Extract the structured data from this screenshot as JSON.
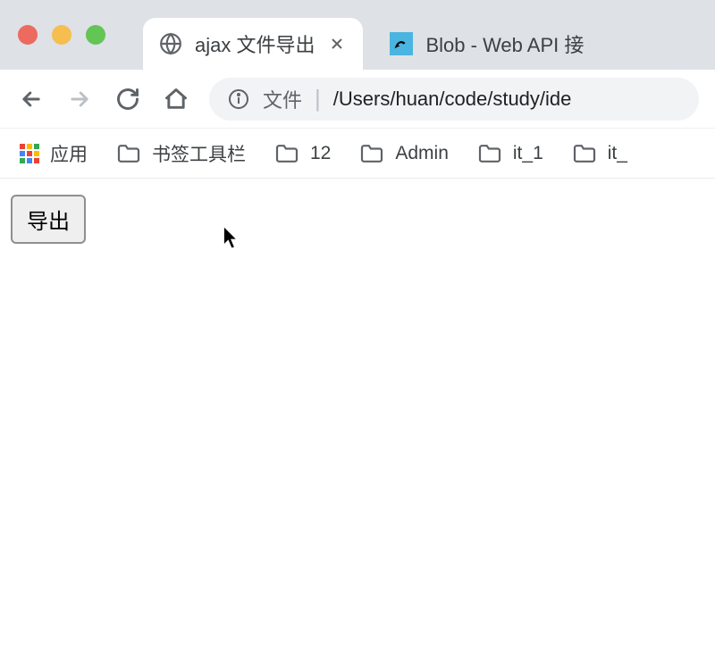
{
  "tabs": {
    "active": {
      "title": "ajax 文件导出"
    },
    "inactive": {
      "title": "Blob - Web API 接口"
    }
  },
  "omnibox": {
    "scheme": "文件",
    "path": "/Users/huan/code/study/ide"
  },
  "bookmarks": {
    "apps_label": "应用",
    "items": [
      {
        "label": "书签工具栏"
      },
      {
        "label": "12"
      },
      {
        "label": "Admin"
      },
      {
        "label": "it_1"
      },
      {
        "label": "it_"
      }
    ]
  },
  "page": {
    "export_button": "导出"
  }
}
